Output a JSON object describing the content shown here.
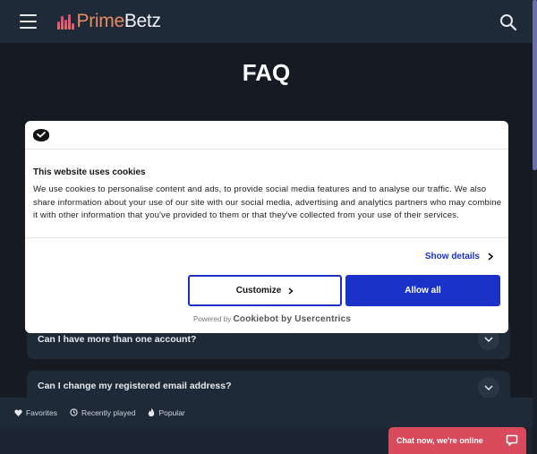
{
  "header": {
    "logo_prime": "Prime",
    "logo_betz": "Betz",
    "menu_icon": "hamburger-menu-icon",
    "search_icon": "search-icon"
  },
  "page": {
    "title": "FAQ"
  },
  "faq": {
    "items": [
      {
        "question": "Can I have more than one account?"
      },
      {
        "question": "Can I change my registered email address?"
      }
    ]
  },
  "cookie_banner": {
    "title": "This website uses cookies",
    "body": "We use cookies to personalise content and ads, to provide social media features and to analyse our traffic. We also share information about your use of our site with our social media, advertising and analytics partners who may combine it with other information that you've provided to them or that they've collected from your use of their services.",
    "show_details": "Show details",
    "customize": "Customize",
    "allow_all": "Allow all",
    "powered_prefix": "Powered by",
    "powered_brand": "Cookiebot by Usercentrics",
    "accent_color": "#1a32c8"
  },
  "bottom_bar": {
    "items": [
      {
        "label": "Favorites",
        "icon": "heart-icon"
      },
      {
        "label": "Recently played",
        "icon": "clock-icon"
      },
      {
        "label": "Popular",
        "icon": "fire-icon"
      }
    ]
  },
  "chat": {
    "label": "Chat now, we're online",
    "icon": "chat-bubble-icon",
    "color": "#d94a5c"
  }
}
